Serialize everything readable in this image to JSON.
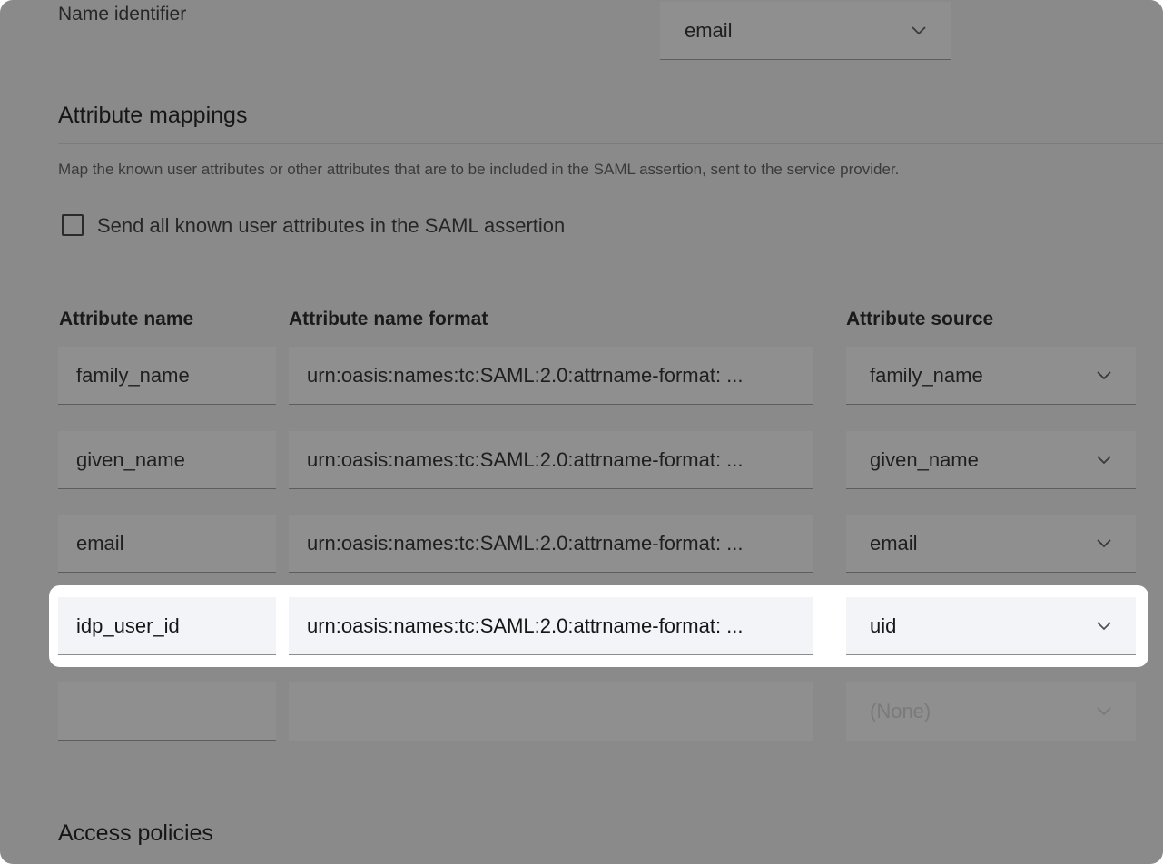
{
  "name_identifier": {
    "label": "Name identifier",
    "value": "email"
  },
  "attribute_mappings": {
    "title": "Attribute mappings",
    "description": "Map the known user attributes or other attributes that are to be included in the SAML assertion, sent to the service provider.",
    "send_all_label": "Send all known user attributes in the SAML assertion",
    "send_all_checked": false,
    "columns": {
      "name": "Attribute name",
      "format": "Attribute name format",
      "source": "Attribute source"
    },
    "rows": [
      {
        "name": "family_name",
        "format": "urn:oasis:names:tc:SAML:2.0:attrname-format: ...",
        "source": "family_name"
      },
      {
        "name": "given_name",
        "format": "urn:oasis:names:tc:SAML:2.0:attrname-format: ...",
        "source": "given_name"
      },
      {
        "name": "email",
        "format": "urn:oasis:names:tc:SAML:2.0:attrname-format: ...",
        "source": "email"
      },
      {
        "name": "idp_user_id",
        "format": "urn:oasis:names:tc:SAML:2.0:attrname-format: ...",
        "source": "uid"
      },
      {
        "name": "",
        "format": "",
        "source": "(None)"
      }
    ]
  },
  "access_policies": {
    "title": "Access policies"
  },
  "colors": {
    "overlay": "#8a8a8a",
    "highlight_bg": "#ffffff",
    "field_bg": "#f2f4f8"
  }
}
